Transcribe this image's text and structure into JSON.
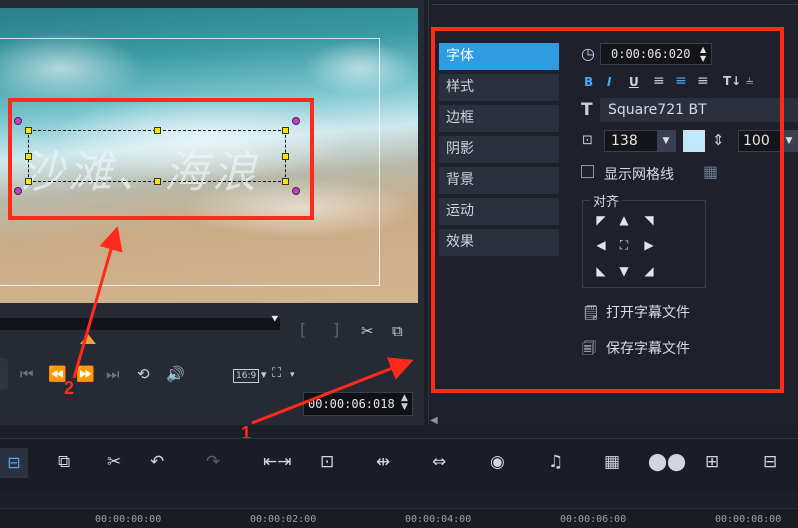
{
  "preview": {
    "overlay_text": "沙滩、海浪"
  },
  "player": {
    "aspect_label": "16:9",
    "timecode": "00:00:06:018"
  },
  "annotations": {
    "label_1": "1",
    "label_2": "2",
    "color": "#ff2a1a"
  },
  "options": {
    "tabs": [
      "字体",
      "样式",
      "边框",
      "阴影",
      "背景",
      "运动",
      "效果"
    ],
    "active_tab": "字体",
    "duration": "0:00:06:020",
    "format_buttons": [
      "B",
      "I",
      "U"
    ],
    "font_name": "Square721 BT",
    "font_size": "138",
    "line_spacing": "100",
    "text_color": "#bfe8ff",
    "show_grid_label": "显示网格线",
    "align_title": "对齐",
    "open_subtitle_label": "打开字幕文件",
    "save_subtitle_label": "保存字幕文件"
  },
  "timeline": {
    "ticks": [
      "00:00:00:00",
      "00:00:02:00",
      "00:00:04:00",
      "00:00:06:00",
      "00:00:08:00"
    ]
  },
  "colors": {
    "accent": "#2f9be0",
    "playhead": "#f0a33a",
    "handle": "#ffe600",
    "rotate_handle": "#d334d1"
  }
}
